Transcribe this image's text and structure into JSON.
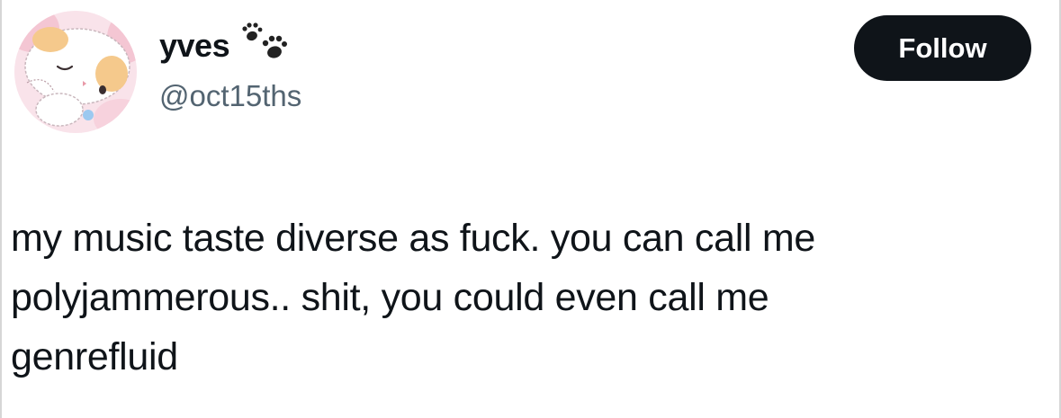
{
  "tweet": {
    "author": {
      "display_name": "yves",
      "handle": "@oct15ths",
      "name_emoji_icon": "paw-prints-icon",
      "avatar_icon": "cartoon-kitten-avatar"
    },
    "follow_button_label": "Follow",
    "text_lines": [
      "my music taste diverse as fuck. you can call me",
      "polyjammerous.. shit, you could even call me",
      "genrefluid"
    ]
  },
  "colors": {
    "text_primary": "#0f1419",
    "text_secondary": "#536471",
    "button_bg": "#0f1419",
    "button_text": "#ffffff",
    "background": "#ffffff"
  }
}
